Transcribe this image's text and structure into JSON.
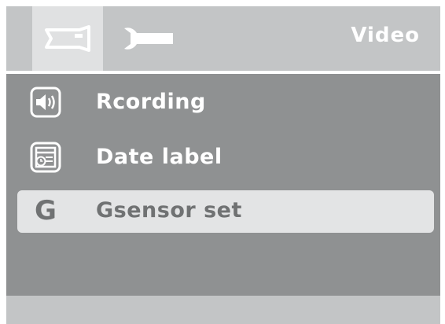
{
  "header": {
    "title": "Video",
    "tabs": [
      {
        "icon": "camcorder-icon",
        "active": true
      },
      {
        "icon": "wrench-icon",
        "active": false
      }
    ]
  },
  "menu": {
    "items": [
      {
        "icon": "speaker-icon",
        "label": "Rcording",
        "selected": false
      },
      {
        "icon": "calendar-clock-icon",
        "label": "Date label",
        "selected": false
      },
      {
        "icon": "g-sensor-icon",
        "icon_text": "G",
        "label": "Gsensor set",
        "selected": true
      }
    ]
  },
  "colors": {
    "background": "#8f9192",
    "header": "#c3c5c6",
    "selected": "#e3e4e5",
    "text": "#ffffff",
    "selected_text": "#707273"
  }
}
